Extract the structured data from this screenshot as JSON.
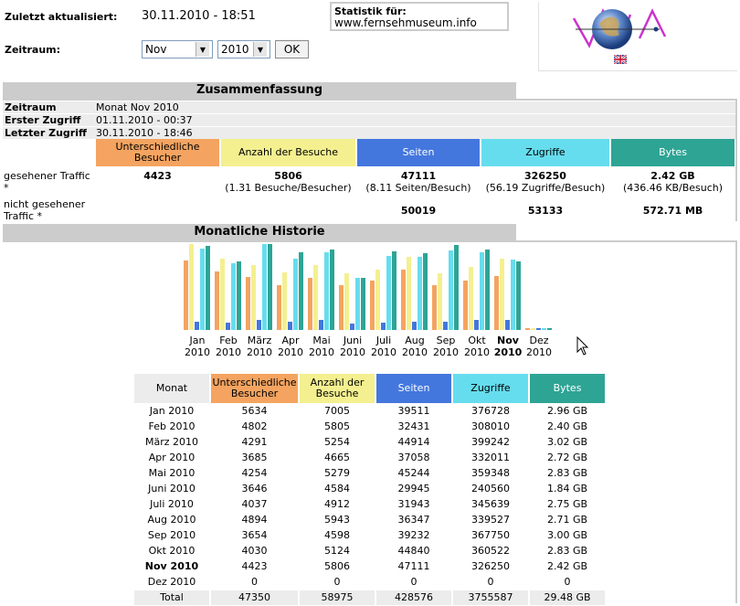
{
  "header": {
    "last_update_label": "Zuletzt aktualisiert:",
    "last_update_value": "30.11.2010 - 18:51",
    "period_label": "Zeitraum:",
    "month_select": "Nov",
    "year_select": "2010",
    "ok_label": "OK",
    "stats_for_label": "Statistik für:",
    "stats_for_site": "www.fernsehmuseum.info"
  },
  "colors": {
    "visitors": "#f4a460",
    "visits": "#f4f090",
    "pages": "#4477dd",
    "hits": "#66ddee",
    "bytes": "#2ea495"
  },
  "summary": {
    "title": "Zusammenfassung",
    "period_label": "Zeitraum",
    "period_value": "Monat Nov 2010",
    "first_label": "Erster Zugriff",
    "first_value": "01.11.2010 - 00:37",
    "last_label": "Letzter Zugriff",
    "last_value": "30.11.2010 - 18:46",
    "col_visitors": "Unterschiedliche Besucher",
    "col_visits": "Anzahl der Besuche",
    "col_pages": "Seiten",
    "col_hits": "Zugriffe",
    "col_bytes": "Bytes",
    "seen_label": "gesehener Traffic *",
    "seen_visitors": "4423",
    "seen_visits": "5806",
    "seen_visits_sub": "(1.31 Besuche/Besucher)",
    "seen_pages": "47111",
    "seen_pages_sub": "(8.11 Seiten/Besuch)",
    "seen_hits": "326250",
    "seen_hits_sub": "(56.19 Zugriffe/Besuch)",
    "seen_bytes": "2.42 GB",
    "seen_bytes_sub": "(436.46 KB/Besuch)",
    "unseen_label": "nicht gesehener Traffic *",
    "unseen_pages": "50019",
    "unseen_hits": "53133",
    "unseen_bytes": "572.71 MB"
  },
  "history": {
    "title": "Monatliche Historie",
    "col_month": "Monat",
    "col_visitors": "Unterschiedliche Besucher",
    "col_visits": "Anzahl der Besuche",
    "col_pages": "Seiten",
    "col_hits": "Zugriffe",
    "col_bytes": "Bytes",
    "rows": [
      {
        "month": "Jan 2010",
        "visitors": "5634",
        "visits": "7005",
        "pages": "39511",
        "hits": "376728",
        "bytes": "2.96 GB"
      },
      {
        "month": "Feb 2010",
        "visitors": "4802",
        "visits": "5805",
        "pages": "32431",
        "hits": "308010",
        "bytes": "2.40 GB"
      },
      {
        "month": "März 2010",
        "visitors": "4291",
        "visits": "5254",
        "pages": "44914",
        "hits": "399242",
        "bytes": "3.02 GB"
      },
      {
        "month": "Apr 2010",
        "visitors": "3685",
        "visits": "4665",
        "pages": "37058",
        "hits": "332011",
        "bytes": "2.72 GB"
      },
      {
        "month": "Mai 2010",
        "visitors": "4254",
        "visits": "5279",
        "pages": "45244",
        "hits": "359348",
        "bytes": "2.83 GB"
      },
      {
        "month": "Juni 2010",
        "visitors": "3646",
        "visits": "4584",
        "pages": "29945",
        "hits": "240560",
        "bytes": "1.84 GB"
      },
      {
        "month": "Juli 2010",
        "visitors": "4037",
        "visits": "4912",
        "pages": "31943",
        "hits": "345639",
        "bytes": "2.75 GB"
      },
      {
        "month": "Aug 2010",
        "visitors": "4894",
        "visits": "5943",
        "pages": "36347",
        "hits": "339527",
        "bytes": "2.71 GB"
      },
      {
        "month": "Sep 2010",
        "visitors": "3654",
        "visits": "4598",
        "pages": "39232",
        "hits": "367750",
        "bytes": "3.00 GB"
      },
      {
        "month": "Okt 2010",
        "visitors": "4030",
        "visits": "5124",
        "pages": "44840",
        "hits": "360522",
        "bytes": "2.83 GB"
      },
      {
        "month": "Nov 2010",
        "visitors": "4423",
        "visits": "5806",
        "pages": "47111",
        "hits": "326250",
        "bytes": "2.42 GB",
        "current": true
      },
      {
        "month": "Dez 2010",
        "visitors": "0",
        "visits": "0",
        "pages": "0",
        "hits": "0",
        "bytes": "0"
      }
    ],
    "total": {
      "month": "Total",
      "visitors": "47350",
      "visits": "58975",
      "pages": "428576",
      "hits": "3755587",
      "bytes": "29.48 GB"
    }
  },
  "chart_data": {
    "type": "bar",
    "categories": [
      "Jan 2010",
      "Feb 2010",
      "März 2010",
      "Apr 2010",
      "Mai 2010",
      "Juni 2010",
      "Juli 2010",
      "Aug 2010",
      "Sep 2010",
      "Okt 2010",
      "Nov 2010",
      "Dez 2010"
    ],
    "category_labels": [
      [
        "Jan",
        "2010"
      ],
      [
        "Feb",
        "2010"
      ],
      [
        "März",
        "2010"
      ],
      [
        "Apr",
        "2010"
      ],
      [
        "Mai",
        "2010"
      ],
      [
        "Juni",
        "2010"
      ],
      [
        "Juli",
        "2010"
      ],
      [
        "Aug",
        "2010"
      ],
      [
        "Sep",
        "2010"
      ],
      [
        "Okt",
        "2010"
      ],
      [
        "Nov",
        "2010"
      ],
      [
        "Dez",
        "2010"
      ]
    ],
    "current_index": 10,
    "series": [
      {
        "values": [
          5634,
          4802,
          4291,
          3685,
          4254,
          3646,
          4037,
          4894,
          3654,
          4030,
          4423,
          0
        ]
      },
      {
        "values": [
          7005,
          5805,
          5254,
          4665,
          5279,
          4584,
          4912,
          5943,
          4598,
          5124,
          5806,
          0
        ]
      },
      {
        "values": [
          39511,
          32431,
          44914,
          37058,
          45244,
          29945,
          31943,
          36347,
          39232,
          44840,
          47111,
          0
        ]
      },
      {
        "values": [
          376728,
          308010,
          399242,
          332011,
          359348,
          240560,
          345639,
          339527,
          367750,
          360522,
          326250,
          0
        ]
      },
      {
        "values": [
          2.96,
          2.4,
          3.02,
          2.72,
          2.83,
          1.84,
          2.75,
          2.71,
          3.0,
          2.83,
          2.42,
          0
        ]
      }
    ]
  }
}
